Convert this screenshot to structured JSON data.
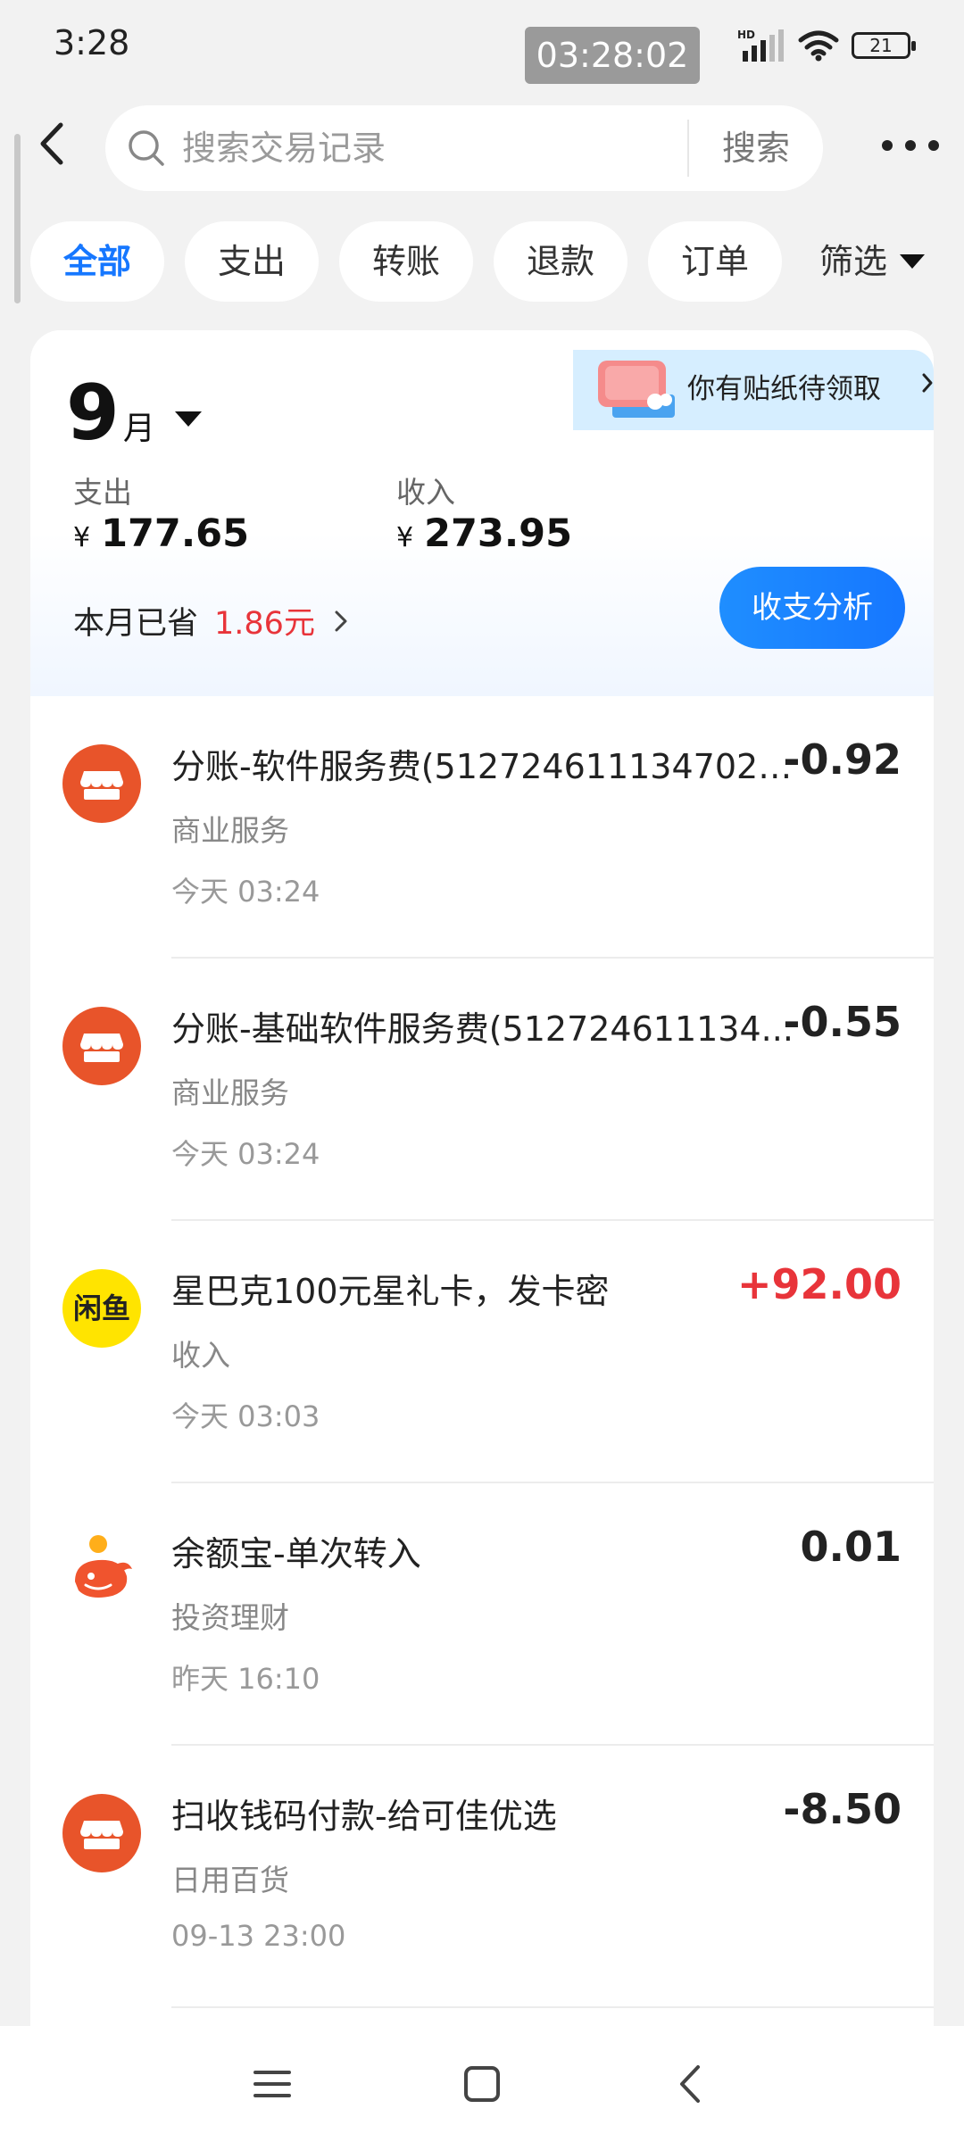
{
  "status_bar": {
    "time": "3:28",
    "clock": "03:28:02",
    "battery": "21",
    "icons": [
      "hd-signal-icon",
      "wifi-icon",
      "battery-icon"
    ]
  },
  "header": {
    "search_placeholder": "搜索交易记录",
    "search_button": "搜索"
  },
  "tabs": [
    {
      "label": "全部",
      "active": true
    },
    {
      "label": "支出",
      "active": false
    },
    {
      "label": "转账",
      "active": false
    },
    {
      "label": "退款",
      "active": false
    },
    {
      "label": "订单",
      "active": false
    }
  ],
  "filter_label": "筛选",
  "summary": {
    "sticker_text": "你有贴纸待领取",
    "month_number": "9",
    "month_unit": "月",
    "expense_label": "支出",
    "expense_currency": "¥",
    "expense_value": "177.65",
    "income_label": "收入",
    "income_currency": "¥",
    "income_value": "273.95",
    "saved_label": "本月已省",
    "saved_amount": "1.86元",
    "analyze_button": "收支分析"
  },
  "transactions": [
    {
      "title": "分账-软件服务费(5127246111347028...",
      "category": "商业服务",
      "time": "今天 03:24",
      "amount": "-0.92",
      "type": "expense",
      "icon": "store-icon"
    },
    {
      "title": "分账-基础软件服务费(512724611134...",
      "category": "商业服务",
      "time": "今天 03:24",
      "amount": "-0.55",
      "type": "expense",
      "icon": "store-icon"
    },
    {
      "title": "星巴克100元星礼卡，发卡密",
      "category": "收入",
      "time": "今天 03:03",
      "amount": "+92.00",
      "type": "income",
      "icon": "xianyu-icon",
      "icon_text": "闲鱼"
    },
    {
      "title": "余额宝-单次转入",
      "category": "投资理财",
      "time": "昨天 16:10",
      "amount": "0.01",
      "type": "neutral",
      "icon": "yuebao-icon"
    },
    {
      "title": "扫收钱码付款-给可佳优选",
      "category": "日用百货",
      "time": "09-13 23:00",
      "amount": "-8.50",
      "type": "expense",
      "icon": "store-icon"
    }
  ],
  "colors": {
    "accent": "#1677ff",
    "income": "#e8343a",
    "merchant_icon": "#e8542a",
    "xianyu_icon": "#ffe400"
  }
}
